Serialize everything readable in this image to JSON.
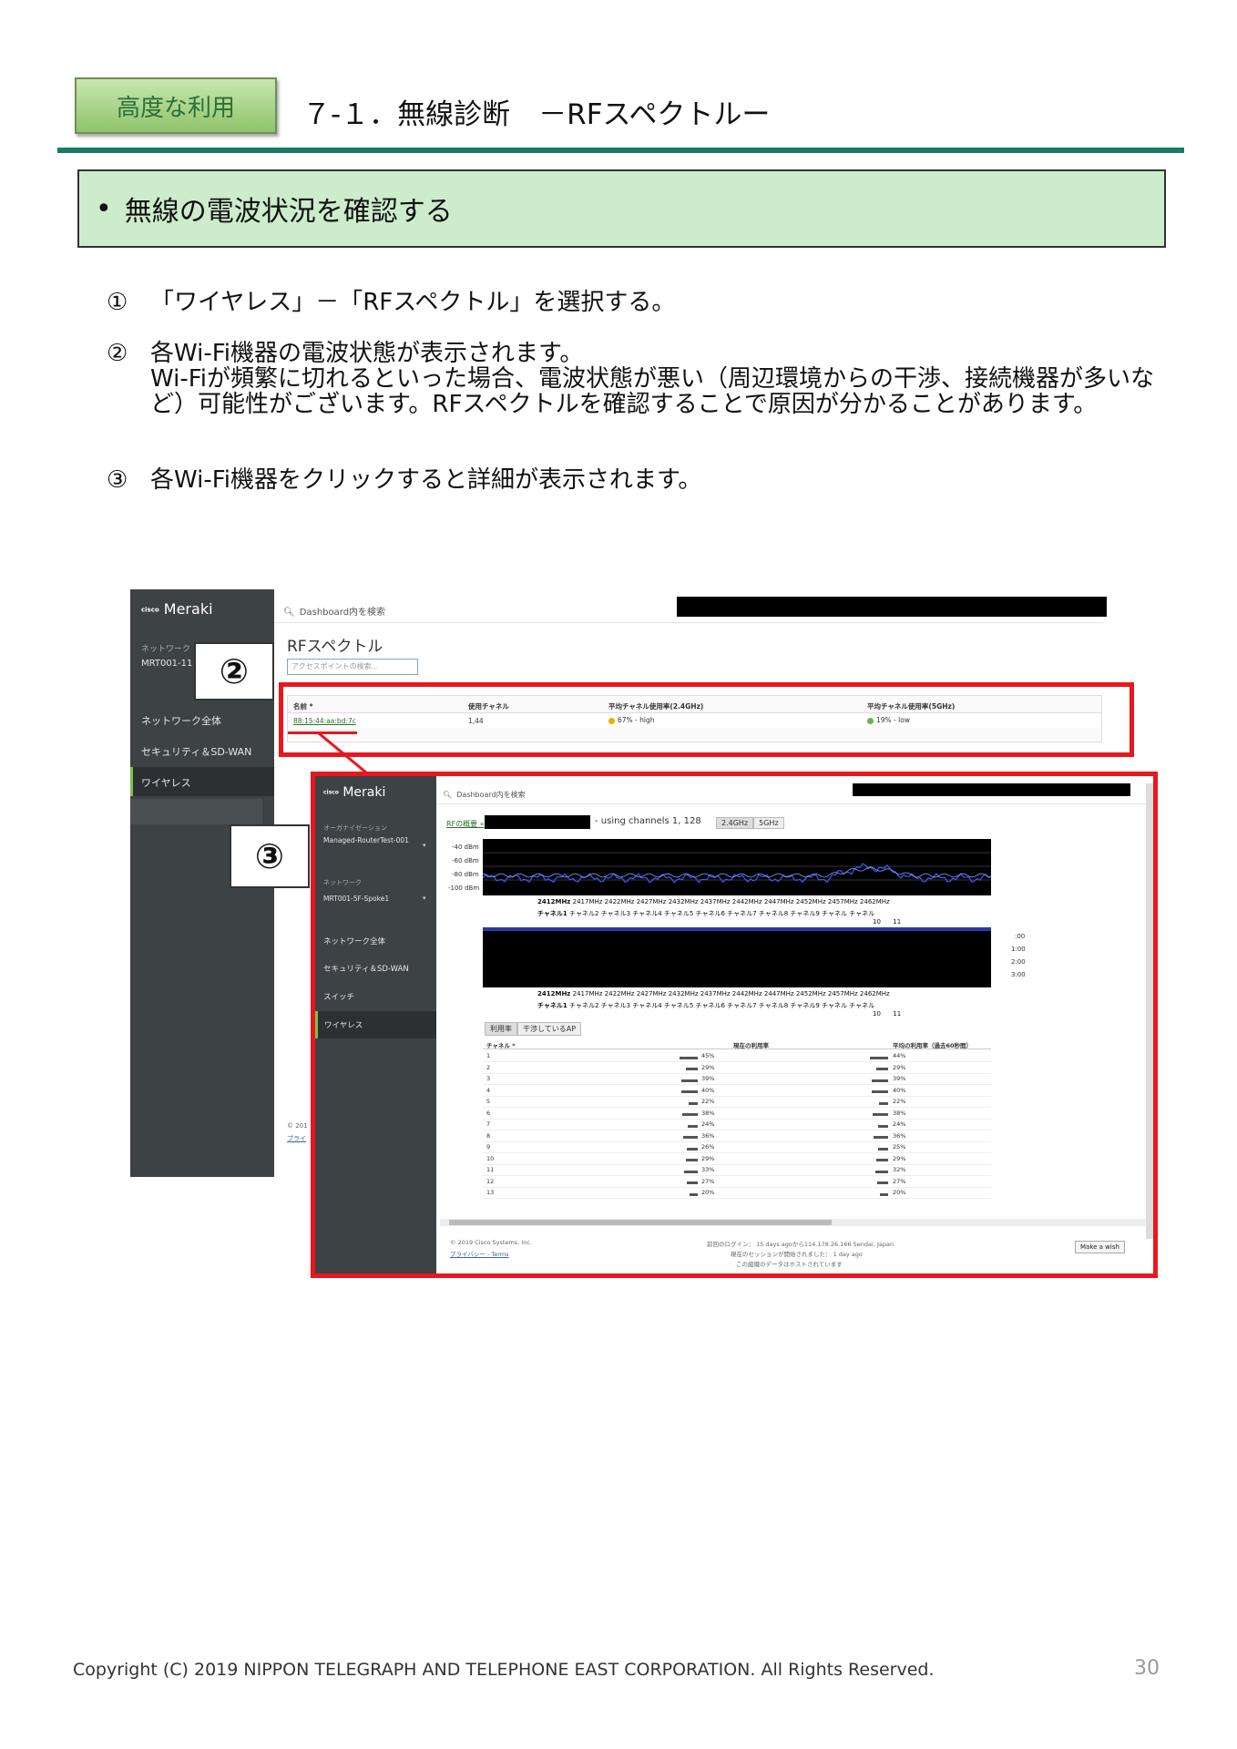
{
  "header": {
    "badge": "高度な利用",
    "title": "７-１．無線診断　－RFスペクトルー"
  },
  "info_box": {
    "bullet": "•",
    "text": "無線の電波状況を確認する"
  },
  "steps": [
    {
      "num": "①",
      "text": "「ワイヤレス」－「RFスペクトル」を選択する。"
    },
    {
      "num": "②",
      "text": "各Wi-Fi機器の電波状態が表示されます。\nWi-Fiが頻繁に切れるといった場合、電波状態が悪い（周辺環境からの干渉、接続機器が多いなど）可能性がございます。RFスペクトルを確認することで原因が分かることがあります。"
    },
    {
      "num": "③",
      "text": "各Wi-Fi機器をクリックすると詳細が表示されます。"
    }
  ],
  "screenshot1": {
    "logo_cisco": "cisco",
    "logo_meraki": "Meraki",
    "search_placeholder": "Dashboard内を検索",
    "network_label": "ネットワーク",
    "network_value": "MRT001-11",
    "nav": [
      "ネットワーク全体",
      "セキュリティ＆SD-WAN",
      "ワイヤレス"
    ],
    "page_title": "RFスペクトル",
    "ap_search_placeholder": "アクセスポイントの検索...",
    "table_headers": [
      "名前 *",
      "使用チャネル",
      "平均チャネル使用率(2.4GHz)",
      "平均チャネル使用率(5GHz)"
    ],
    "row": {
      "name": "88:15:44:aa:bd:7c",
      "channels": "1,44",
      "util24": "67% - high",
      "util5": "19% - low"
    },
    "footer_copy": "© 201",
    "footer_link": "プライ"
  },
  "callouts": [
    "②",
    "③"
  ],
  "screenshot2": {
    "logo_cisco": "cisco",
    "logo_meraki": "Meraki",
    "search_placeholder": "Dashboard内を検索",
    "org_label": "オーガナイゼーション",
    "org_value": "Managed-RouterTest-001",
    "network_label": "ネットワーク",
    "network_value": "MRT001-5F-Spoke1",
    "nav": [
      "ネットワーク全体",
      "セキュリティ＆SD-WAN",
      "スイッチ",
      "ワイヤレス"
    ],
    "breadcrumb": "RFの概要 »",
    "channels_text": "- using channels 1, 128",
    "band_tabs": [
      "2.4GHz",
      "5GHz"
    ],
    "dbm_labels": [
      "-40 dBm",
      "-60 dBm",
      "-80 dBm",
      "-100 dBm"
    ],
    "freqs": [
      "2412MHz",
      "2417MHz",
      "2422MHz",
      "2427MHz",
      "2432MHz",
      "2437MHz",
      "2442MHz",
      "2447MHz",
      "2452MHz",
      "2457MHz",
      "2462MHz"
    ],
    "channels_line": [
      "チャネル1",
      "チャネル2",
      "チャネル3",
      "チャネル4",
      "チャネル5",
      "チャネル6",
      "チャネル7",
      "チャネル8",
      "チャネル9",
      "チャネル",
      "チャネル"
    ],
    "channels_line2": [
      "10",
      "11"
    ],
    "time_labels": [
      ":00",
      "1:00",
      "2:00",
      "3:00"
    ],
    "util_tabs": [
      "利用率",
      "干渉しているAP"
    ],
    "table_headers": [
      "チャネル *",
      "現在の利用率",
      "平均の利用率（過去60秒間）"
    ],
    "rows": [
      {
        "ch": "1",
        "cur": "45%",
        "avg": "44%"
      },
      {
        "ch": "2",
        "cur": "29%",
        "avg": "29%"
      },
      {
        "ch": "3",
        "cur": "39%",
        "avg": "39%"
      },
      {
        "ch": "4",
        "cur": "40%",
        "avg": "40%"
      },
      {
        "ch": "5",
        "cur": "22%",
        "avg": "22%"
      },
      {
        "ch": "6",
        "cur": "38%",
        "avg": "38%"
      },
      {
        "ch": "7",
        "cur": "24%",
        "avg": "24%"
      },
      {
        "ch": "8",
        "cur": "36%",
        "avg": "36%"
      },
      {
        "ch": "9",
        "cur": "26%",
        "avg": "25%"
      },
      {
        "ch": "10",
        "cur": "29%",
        "avg": "29%"
      },
      {
        "ch": "11",
        "cur": "33%",
        "avg": "32%"
      },
      {
        "ch": "12",
        "cur": "27%",
        "avg": "27%"
      },
      {
        "ch": "13",
        "cur": "20%",
        "avg": "20%"
      }
    ],
    "footer_copy": "© 2019 Cisco Systems, Inc.",
    "footer_privacy": "プライバシー - Terms",
    "footer_login": "前回のログイン： 15 days agoから114.178.26.166 Sendai, Japan",
    "footer_session": "現在のセッションが開始されました： 1 day ago",
    "footer_data": "この組織のデータはホストされています",
    "wish_button": "Make a wish"
  },
  "footer": {
    "copyright": "Copyright (C) 2019 NIPPON TELEGRAPH AND TELEPHONE EAST CORPORATION. All Rights Reserved.",
    "page_number": "30"
  }
}
